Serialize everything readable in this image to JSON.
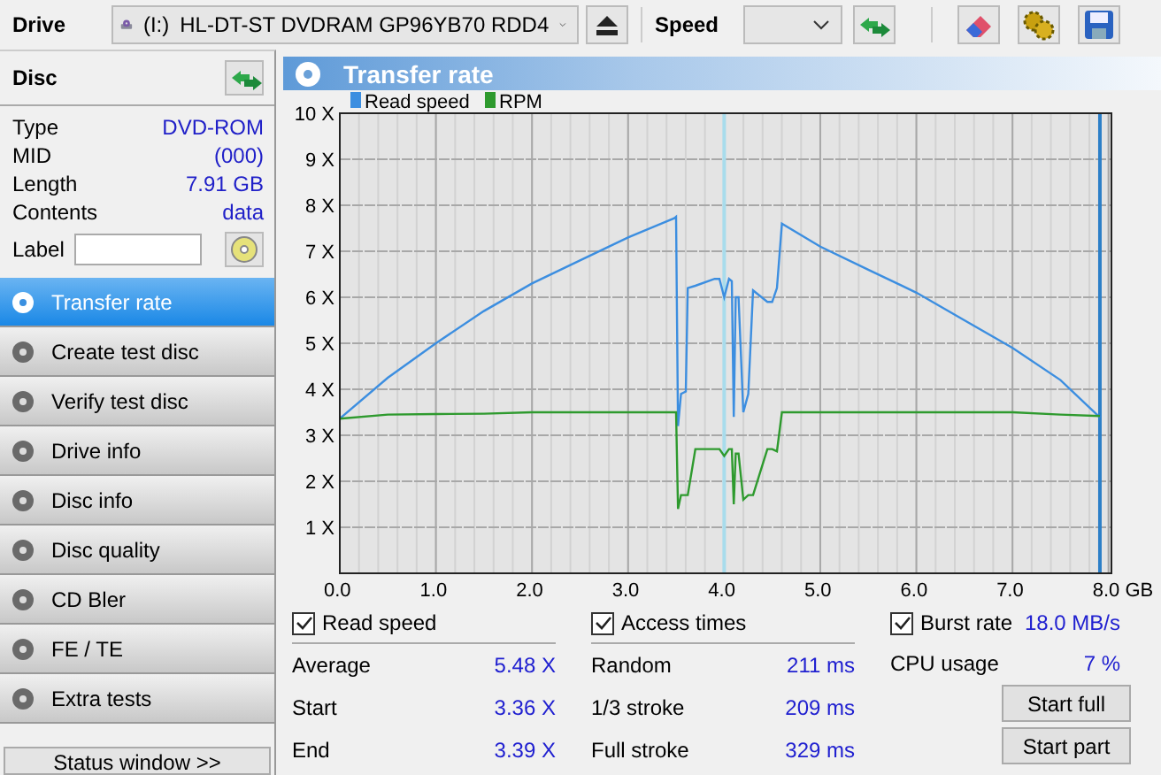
{
  "toolbar": {
    "drive_label": "Drive",
    "drive_letter": "(I:)",
    "drive_name": "HL-DT-ST DVDRAM GP96YB70 RDD4",
    "speed_label": "Speed"
  },
  "disc": {
    "title": "Disc",
    "info": [
      {
        "label": "Type",
        "value": "DVD-ROM"
      },
      {
        "label": "MID",
        "value": "(000)"
      },
      {
        "label": "Length",
        "value": "7.91 GB"
      },
      {
        "label": "Contents",
        "value": "data"
      }
    ],
    "label_field": {
      "label": "Label"
    }
  },
  "nav": [
    {
      "label": "Transfer rate",
      "selected": true
    },
    {
      "label": "Create test disc",
      "selected": false
    },
    {
      "label": "Verify test disc",
      "selected": false
    },
    {
      "label": "Drive info",
      "selected": false
    },
    {
      "label": "Disc info",
      "selected": false
    },
    {
      "label": "Disc quality",
      "selected": false
    },
    {
      "label": "CD Bler",
      "selected": false
    },
    {
      "label": "FE / TE",
      "selected": false
    },
    {
      "label": "Extra tests",
      "selected": false
    }
  ],
  "status_button": "Status window >>",
  "panel": {
    "title": "Transfer rate",
    "chart_data": {
      "type": "line",
      "xlim": [
        0,
        8.03
      ],
      "ylim": [
        0,
        10
      ],
      "grid": true,
      "legend": "top-left",
      "xticks": [
        {
          "value": 0,
          "label": "0.0"
        },
        {
          "value": 1,
          "label": "1.0"
        },
        {
          "value": 2,
          "label": "2.0"
        },
        {
          "value": 3,
          "label": "3.0"
        },
        {
          "value": 4,
          "label": "4.0"
        },
        {
          "value": 5,
          "label": "5.0"
        },
        {
          "value": 6,
          "label": "6.0"
        },
        {
          "value": 7,
          "label": "7.0"
        },
        {
          "value": 8,
          "label": "8.0 GB"
        }
      ],
      "yticks": [
        {
          "value": 1,
          "label": "1 X"
        },
        {
          "value": 2,
          "label": "2 X"
        },
        {
          "value": 3,
          "label": "3 X"
        },
        {
          "value": 4,
          "label": "4 X"
        },
        {
          "value": 5,
          "label": "5 X"
        },
        {
          "value": 6,
          "label": "6 X"
        },
        {
          "value": 7,
          "label": "7 X"
        },
        {
          "value": 8,
          "label": "8 X"
        },
        {
          "value": 9,
          "label": "9 X"
        },
        {
          "value": 10,
          "label": "10 X"
        }
      ],
      "x": [
        0,
        0.5,
        1,
        1.5,
        2,
        2.5,
        3,
        3.48,
        3.5,
        3.52,
        3.55,
        3.6,
        3.62,
        3.7,
        3.9,
        3.95,
        4,
        4.05,
        4.08,
        4.1,
        4.12,
        4.15,
        4.2,
        4.25,
        4.3,
        4.45,
        4.5,
        4.55,
        4.6,
        5,
        5.5,
        6,
        6.5,
        7,
        7.5,
        7.91
      ],
      "series": [
        {
          "name": "Read speed",
          "color": "#3c8ee0",
          "values": [
            3.36,
            4.25,
            5.0,
            5.7,
            6.3,
            6.8,
            7.3,
            7.72,
            7.75,
            3.2,
            3.9,
            3.95,
            6.2,
            6.25,
            6.4,
            6.4,
            6.0,
            6.4,
            6.35,
            3.4,
            6.0,
            6.0,
            3.5,
            3.9,
            6.15,
            5.9,
            5.9,
            6.2,
            7.6,
            7.1,
            6.6,
            6.1,
            5.5,
            4.9,
            4.2,
            3.39
          ]
        },
        {
          "name": "RPM",
          "color": "#2e9a2e",
          "values": [
            3.36,
            3.45,
            3.46,
            3.47,
            3.5,
            3.5,
            3.5,
            3.5,
            3.5,
            1.4,
            1.7,
            1.7,
            1.7,
            2.7,
            2.7,
            2.7,
            2.55,
            2.7,
            2.7,
            1.5,
            2.6,
            2.6,
            1.6,
            1.7,
            1.7,
            2.7,
            2.7,
            2.65,
            3.5,
            3.5,
            3.5,
            3.5,
            3.5,
            3.5,
            3.45,
            3.42
          ]
        }
      ],
      "ref_lines": [
        {
          "axis": "x",
          "value": 4.0,
          "color": "#a8dcec"
        },
        {
          "axis": "x",
          "value": 7.91,
          "color": "#2c7fc8"
        }
      ]
    }
  },
  "options": [
    {
      "kind": "checkbox",
      "label": "Read speed",
      "checked": true
    },
    {
      "kind": "checkbox",
      "label": "Access times",
      "checked": true
    },
    {
      "kind": "checkbox",
      "label": "Burst rate",
      "checked": true,
      "value": "18.0 MB/s"
    }
  ],
  "stats": [
    [
      {
        "label": "Average",
        "value": "5.48 X"
      },
      {
        "label": "Start",
        "value": "3.36 X"
      },
      {
        "label": "End",
        "value": "3.39 X"
      }
    ],
    [
      {
        "label": "Random",
        "value": "211 ms"
      },
      {
        "label": "1/3 stroke",
        "value": "209 ms"
      },
      {
        "label": "Full stroke",
        "value": "329 ms"
      }
    ],
    [
      {
        "label": "CPU usage",
        "value": "7 %"
      }
    ]
  ],
  "buttons": [
    "Start full",
    "Start part"
  ]
}
